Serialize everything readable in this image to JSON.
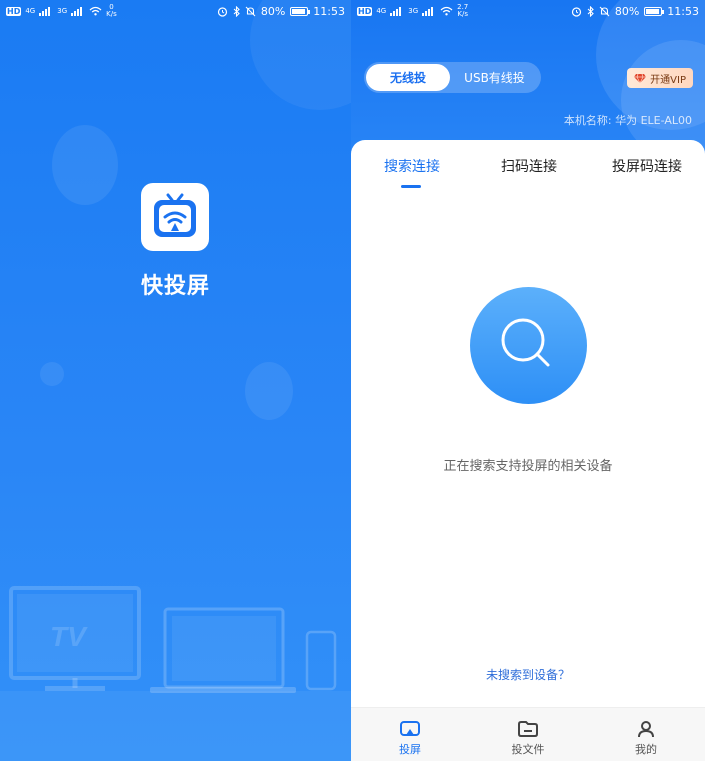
{
  "status_left": {
    "hd": "HD",
    "net1": "4G",
    "net2": "3G",
    "speed_value": "0",
    "speed_unit": "K/s",
    "battery_pct": "80%",
    "time": "11:53",
    "battery_level": 0.8
  },
  "status_right": {
    "hd": "HD",
    "net1": "4G",
    "net2": "3G",
    "speed_value": "2.7",
    "speed_unit": "K/s",
    "battery_pct": "80%",
    "time": "11:53",
    "battery_level": 0.8
  },
  "splash": {
    "app_name": "快投屏",
    "device_tv_label": "TV",
    "background_color": "#1a7bf3"
  },
  "main": {
    "mode_toggle": {
      "active": "无线投",
      "inactive": "USB有线投"
    },
    "vip_label": "开通VIP",
    "device_name": "本机名称: 华为 ELE-AL00",
    "tabs": [
      {
        "label": "搜索连接",
        "active": true
      },
      {
        "label": "扫码连接",
        "active": false
      },
      {
        "label": "投屏码连接",
        "active": false
      }
    ],
    "searching_text": "正在搜索支持投屏的相关设备",
    "not_found_link": "未搜索到设备？",
    "bottom_nav": [
      {
        "label": "投屏",
        "icon": "cast-screen-icon",
        "active": true
      },
      {
        "label": "投文件",
        "icon": "folder-icon",
        "active": false
      },
      {
        "label": "我的",
        "icon": "profile-icon",
        "active": false
      }
    ]
  },
  "colors": {
    "primary_blue": "#1a72f0",
    "header_blue": "#1876f2",
    "vip_bg": "#ffe0cc",
    "vip_text": "#7a3b14"
  }
}
